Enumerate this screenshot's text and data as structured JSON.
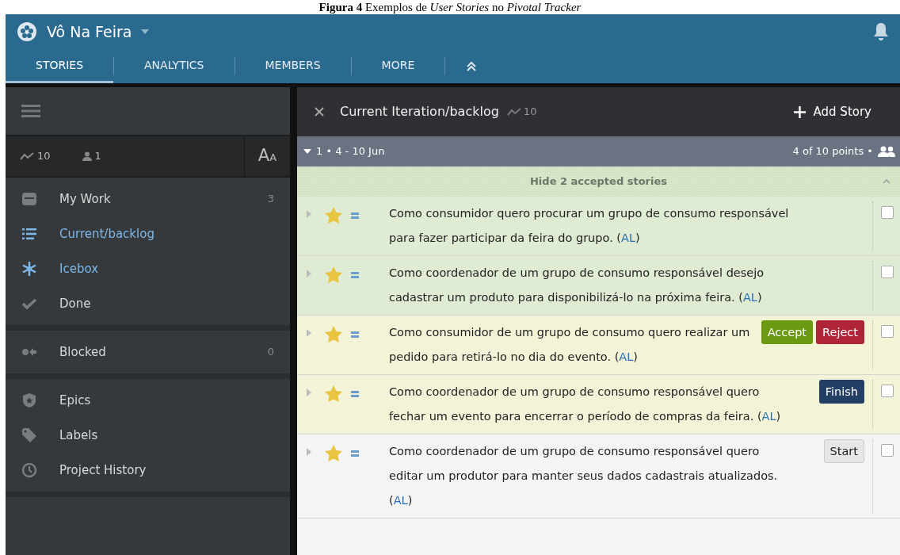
{
  "caption": "**Figura 4** Exemplos de *User Stories* no *Pivotal Tracker*",
  "project": {
    "name": "Vô Na Feira"
  },
  "tabs": [
    {
      "label": "STORIES",
      "selected": true
    },
    {
      "label": "ANALYTICS",
      "selected": false
    },
    {
      "label": "MEMBERS",
      "selected": false
    },
    {
      "label": "MORE",
      "selected": false
    }
  ],
  "sidebar": {
    "velocity": "10",
    "members": "1",
    "font_button": {
      "big": "A",
      "small": "A"
    },
    "groups": [
      {
        "items": [
          {
            "label": "My Work",
            "count": "3",
            "open": false
          },
          {
            "label": "Current/backlog",
            "open": true
          },
          {
            "label": "Icebox",
            "open": true
          },
          {
            "label": "Done",
            "open": false
          }
        ]
      },
      {
        "items": [
          {
            "label": "Blocked",
            "count": "0",
            "open": false
          }
        ]
      },
      {
        "items": [
          {
            "label": "Epics",
            "open": false
          },
          {
            "label": "Labels",
            "open": false
          },
          {
            "label": "Project History",
            "open": false
          }
        ]
      }
    ]
  },
  "panel": {
    "title": "Current Iteration/backlog",
    "velocity": "10",
    "add_button": "Add Story",
    "iteration": {
      "label": "1 • 4 - 10 Jun",
      "points": "4 of 10 points •"
    },
    "accepted_toggle": "Hide 2 accepted stories",
    "stories": [
      {
        "kind": "accepted",
        "text": "Como consumidor quero procurar um grupo de consumo responsável para fazer participar da feira do grupo. (",
        "owner": "AL",
        "suffix": ")",
        "checked": false
      },
      {
        "kind": "accepted",
        "text": "Como coordenador de um grupo de consumo responsável desejo cadastrar um produto para disponibilizá-lo na próxima feira. (",
        "owner": "AL",
        "suffix": ")",
        "checked": false
      },
      {
        "kind": "delivered",
        "text": "Como consumidor de um grupo de consumo quero realizar um pedido para retirá-lo no dia do evento.  (",
        "owner": "AL",
        "suffix": ")",
        "checked": false,
        "buttons": [
          {
            "kind": "accept",
            "label": "Accept"
          },
          {
            "kind": "reject",
            "label": "Reject"
          }
        ]
      },
      {
        "kind": "started",
        "text": "Como coordenador de um grupo de consumo responsável quero fechar um evento para encerrar o período de compras da feira. (",
        "owner": "AL",
        "suffix": ")",
        "checked": false,
        "buttons": [
          {
            "kind": "finish",
            "label": "Finish"
          }
        ]
      },
      {
        "kind": "unstarted",
        "text": "Como coordenador de um grupo de consumo responsável quero editar um produtor para manter seus dados cadastrais atualizados. (",
        "owner": "AL",
        "suffix": ")",
        "checked": false,
        "buttons": [
          {
            "kind": "start",
            "label": "Start"
          }
        ]
      }
    ]
  }
}
